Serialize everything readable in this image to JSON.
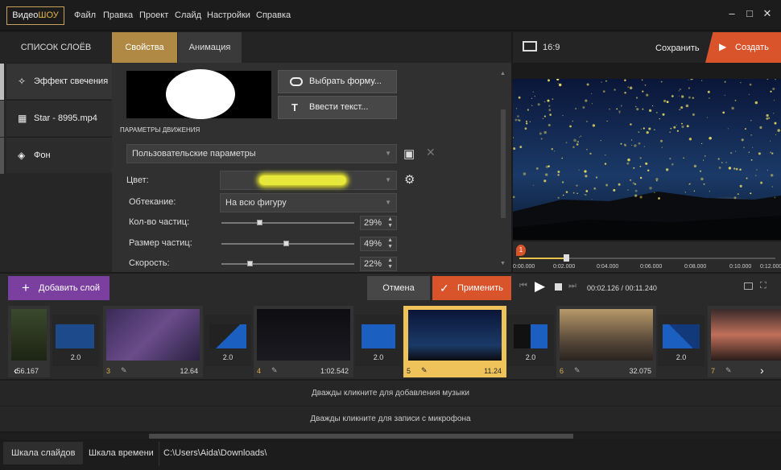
{
  "app": {
    "logo_a": "Видео",
    "logo_b": "ШОУ"
  },
  "menu": [
    "Файл",
    "Правка",
    "Проект",
    "Слайд",
    "Настройки",
    "Справка"
  ],
  "window_controls": {
    "minimize": "–",
    "maximize": "□",
    "close": "✕"
  },
  "tabs": {
    "layers": "СПИСОК СЛОЁВ",
    "properties": "Свойства",
    "animation": "Анимация"
  },
  "layers": [
    {
      "label": "Эффект свечения",
      "icon": "wand-icon"
    },
    {
      "label": "Star - 8995.mp4",
      "icon": "film-icon"
    },
    {
      "label": "Фон",
      "icon": "paint-bucket-icon"
    }
  ],
  "props": {
    "choose_shape": "Выбрать форму...",
    "enter_text": "Ввести текст...",
    "motion_header": "ПАРАМЕТРЫ ДВИЖЕНИЯ",
    "preset": "Пользовательские параметры",
    "color_label": "Цвет:",
    "flow_label": "Обтекание:",
    "flow_value": "На всю фигуру",
    "count_label": "Кол-во частиц:",
    "count_value": "29%",
    "count_level": 0.29,
    "size_label": "Размер частиц:",
    "size_value": "49%",
    "size_level": 0.49,
    "speed_label": "Скорость:",
    "speed_value": "22%",
    "speed_level": 0.22
  },
  "preview": {
    "aspect": "16:9",
    "save": "Сохранить",
    "create": "Создать",
    "marker": "1",
    "ticks": [
      "0:00.000",
      "0:02.000",
      "0:04.000",
      "0:06.000",
      "0:08.000",
      "0:10.000",
      "0:12.000"
    ],
    "playhead_fraction": 0.19
  },
  "actions": {
    "add_layer": "Добавить слой",
    "cancel": "Отмена",
    "apply": "Применить",
    "time": "00:02.126 / 00:11.240"
  },
  "slides": [
    {
      "num": "",
      "dur": ":56.167"
    },
    {
      "num": "3",
      "dur": "12.64"
    },
    {
      "num": "4",
      "dur": "1:02.542"
    },
    {
      "num": "5",
      "dur": "11.24"
    },
    {
      "num": "6",
      "dur": "32.075"
    },
    {
      "num": "7",
      "dur": ""
    }
  ],
  "transitions": [
    "2.0",
    "2.0",
    "2.0",
    "2.0",
    "2.0"
  ],
  "tracks": {
    "music": "Дважды кликните для добавления музыки",
    "mic": "Дважды кликните для записи с микрофона"
  },
  "status": {
    "tab_slides": "Шкала слайдов",
    "tab_timeline": "Шкала времени",
    "path": "C:\\Users\\Aida\\Downloads\\"
  },
  "colors": {
    "accent": "#b08a45",
    "create": "#d9532b",
    "add_layer": "#7b3fa0"
  }
}
